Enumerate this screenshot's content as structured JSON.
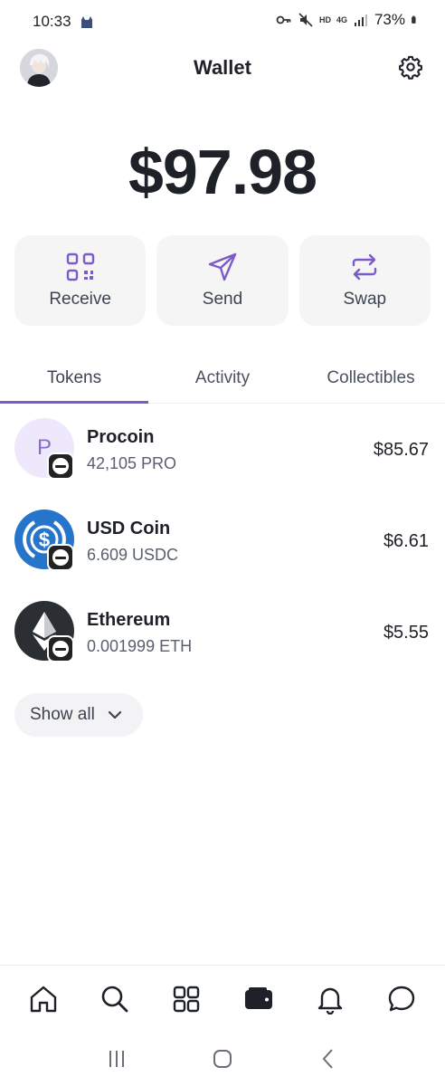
{
  "status_bar": {
    "time": "10:33",
    "hd": "HD",
    "network": "4G",
    "battery": "73%"
  },
  "header": {
    "title": "Wallet"
  },
  "balance": "$97.98",
  "actions": [
    {
      "label": "Receive",
      "icon": "qr-code-icon"
    },
    {
      "label": "Send",
      "icon": "send-icon"
    },
    {
      "label": "Swap",
      "icon": "swap-icon"
    }
  ],
  "tabs": [
    {
      "label": "Tokens",
      "active": true
    },
    {
      "label": "Activity",
      "active": false
    },
    {
      "label": "Collectibles",
      "active": false
    }
  ],
  "tokens": [
    {
      "name": "Procoin",
      "amount": "42,105 PRO",
      "value": "$85.67",
      "logo_letter": "P"
    },
    {
      "name": "USD Coin",
      "amount": "6.609 USDC",
      "value": "$6.61"
    },
    {
      "name": "Ethereum",
      "amount": "0.001999 ETH",
      "value": "$5.55"
    }
  ],
  "show_all": {
    "label": "Show all"
  },
  "bottom_nav": [
    {
      "icon": "home-icon"
    },
    {
      "icon": "search-icon"
    },
    {
      "icon": "apps-grid-icon"
    },
    {
      "icon": "wallet-icon",
      "active": true
    },
    {
      "icon": "bell-icon"
    },
    {
      "icon": "chat-icon"
    }
  ],
  "colors": {
    "accent": "#7b5bc7",
    "text_primary": "#1f2128",
    "card_bg": "#f5f5f6",
    "usdc_blue": "#2775ca"
  }
}
